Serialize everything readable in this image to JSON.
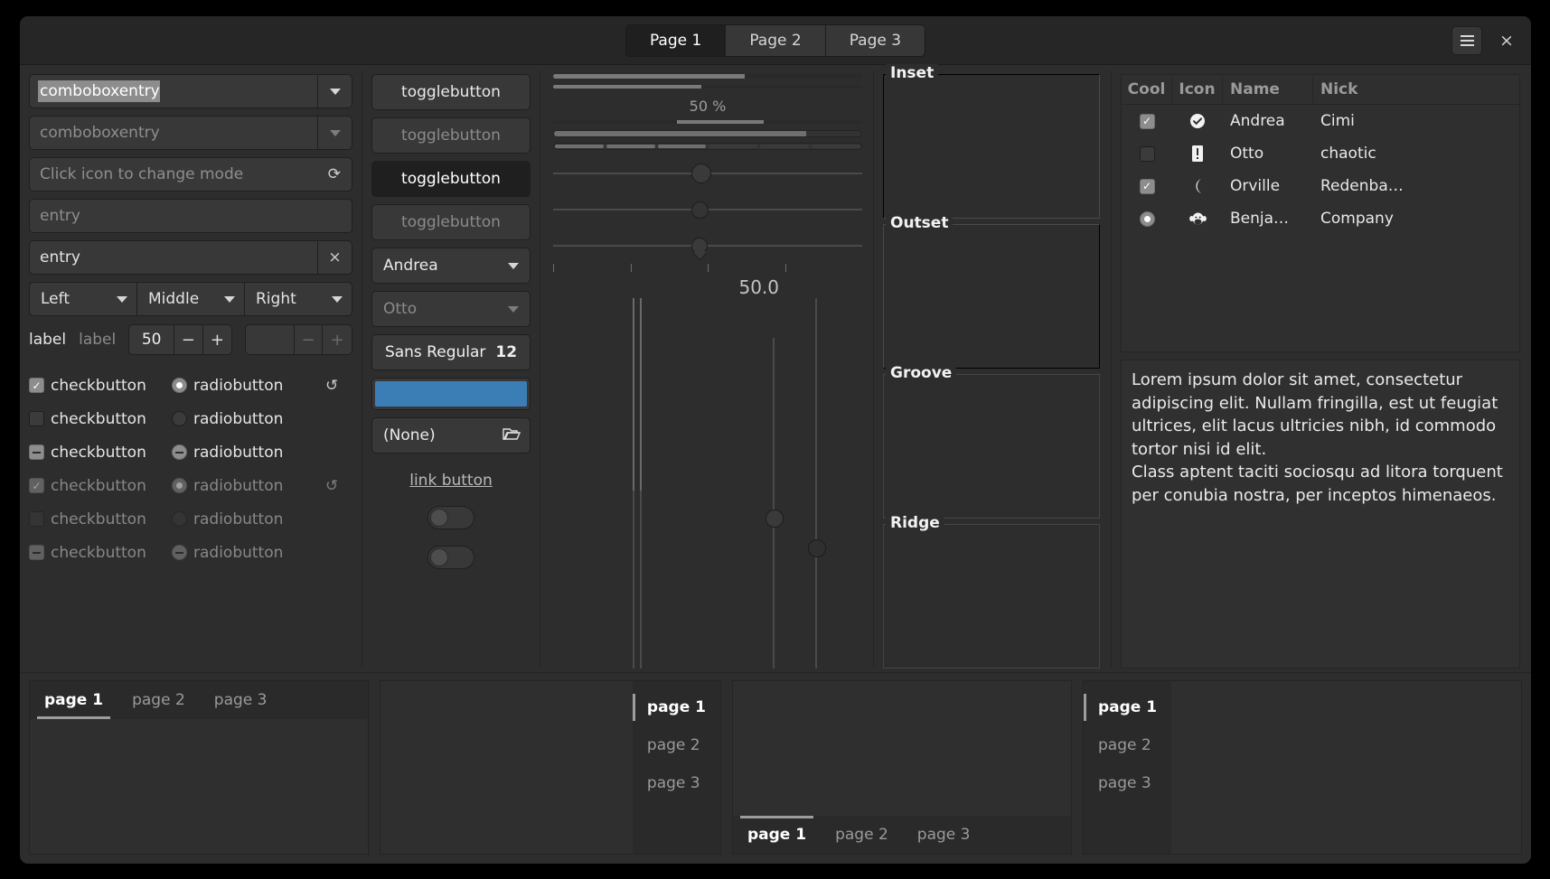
{
  "header": {
    "stack_tabs": [
      {
        "label": "Page 1",
        "active": true
      },
      {
        "label": "Page 2",
        "active": false
      },
      {
        "label": "Page 3",
        "active": false
      }
    ],
    "menu_icon": "hamburger-menu-icon",
    "close_label": "×"
  },
  "column1": {
    "combo_entry_1": {
      "value": "comboboxentry",
      "selected": true
    },
    "combo_entry_2": {
      "value": "comboboxentry",
      "disabled": true
    },
    "mode_entry": {
      "placeholder": "Click icon to change mode",
      "icon": "refresh-icon"
    },
    "entry_placeholder": {
      "placeholder": "entry"
    },
    "entry_filled": {
      "value": "entry",
      "clear_icon": "×"
    },
    "segmented": [
      {
        "label": "Left"
      },
      {
        "label": "Middle"
      },
      {
        "label": "Right"
      }
    ],
    "labels": {
      "label_a": "label",
      "label_b": "label"
    },
    "spin": {
      "value": "50",
      "minus": "−",
      "plus": "+"
    },
    "spin_disabled": {
      "value": "",
      "minus": "−",
      "plus": "+"
    },
    "check_rows": [
      {
        "check_state": "on",
        "check_label": "checkbutton",
        "radio_state": "on",
        "radio_label": "radiobutton",
        "spinner": true,
        "disabled": false
      },
      {
        "check_state": "off",
        "check_label": "checkbutton",
        "radio_state": "off",
        "radio_label": "radiobutton",
        "spinner": false,
        "disabled": false
      },
      {
        "check_state": "mixed",
        "check_label": "checkbutton",
        "radio_state": "mixed",
        "radio_label": "radiobutton",
        "spinner": false,
        "disabled": false
      },
      {
        "check_state": "on",
        "check_label": "checkbutton",
        "radio_state": "on",
        "radio_label": "radiobutton",
        "spinner": true,
        "disabled": true
      },
      {
        "check_state": "off",
        "check_label": "checkbutton",
        "radio_state": "off",
        "radio_label": "radiobutton",
        "spinner": false,
        "disabled": true
      },
      {
        "check_state": "mixed",
        "check_label": "checkbutton",
        "radio_state": "mixed",
        "radio_label": "radiobutton",
        "spinner": false,
        "disabled": true
      }
    ],
    "spinner_glyph": "↺"
  },
  "column2": {
    "toggles": [
      {
        "label": "togglebutton",
        "state": "normal"
      },
      {
        "label": "togglebutton",
        "state": "disabled"
      },
      {
        "label": "togglebutton",
        "state": "pressed"
      },
      {
        "label": "togglebutton",
        "state": "disabled"
      }
    ],
    "combo_normal": "Andrea",
    "combo_disabled": "Otto",
    "font_button": {
      "family": "Sans Regular",
      "size": "12"
    },
    "color_button": {
      "color": "#3a7eb5"
    },
    "file_button": {
      "label": "(None)",
      "icon": "folder-open-icon"
    },
    "link_button": "link button",
    "switches": [
      {
        "state": "off"
      },
      {
        "state": "off"
      }
    ]
  },
  "column3": {
    "progress_1": 62,
    "progress_2": 48,
    "percent_label": "50 %",
    "progress_3_start": 40,
    "progress_3_end": 68,
    "level_bar_value": 82,
    "level_bar_discrete": [
      1,
      1,
      1,
      0,
      0,
      0
    ],
    "scale_1": 48,
    "scale_2": 48,
    "scale_3": 48,
    "ticks": [
      0,
      25,
      50,
      75
    ],
    "big_value": "50.0",
    "vscrollbar_left_value": 28,
    "vscrollbar_mid_value": 65,
    "vscale_value": 57
  },
  "frames": [
    {
      "label": "Inset",
      "style": "inset"
    },
    {
      "label": "Outset",
      "style": "outset"
    },
    {
      "label": "Groove",
      "style": "groove"
    },
    {
      "label": "Ridge",
      "style": "ridge"
    }
  ],
  "treeview": {
    "columns": [
      "Cool",
      "Icon",
      "Name",
      "Nick"
    ],
    "rows": [
      {
        "cool": "check-on",
        "icon": "check-circle-icon",
        "icon_glyph": "✔",
        "name": "Andrea",
        "nick": "Cimi"
      },
      {
        "cool": "check-off",
        "icon": "warning-icon",
        "icon_glyph": "❗",
        "name": "Otto",
        "nick": "chaotic"
      },
      {
        "cool": "check-on",
        "icon": "moon-icon",
        "icon_glyph": "☾",
        "name": "Orville",
        "nick": "Redenba…"
      },
      {
        "cool": "radio-on",
        "icon": "monkey-face-icon",
        "icon_glyph": "ὃ5",
        "name": "Benja…",
        "nick": "Company"
      }
    ]
  },
  "textview": {
    "paragraph_1": "Lorem ipsum dolor sit amet, consectetur adipiscing elit. Nullam fringilla, est ut feugiat ultrices, elit lacus ultricies nibh, id commodo tortor nisi id elit.",
    "paragraph_2": "Class aptent taciti sociosqu ad litora torquent per conubia nostra, per inceptos himenaeos."
  },
  "notebooks": [
    {
      "position": "top",
      "tabs": [
        {
          "label": "page 1",
          "active": true
        },
        {
          "label": "page 2",
          "active": false
        },
        {
          "label": "page 3",
          "active": false
        }
      ]
    },
    {
      "position": "right",
      "tabs": [
        {
          "label": "page 1",
          "active": true
        },
        {
          "label": "page 2",
          "active": false
        },
        {
          "label": "page 3",
          "active": false
        }
      ]
    },
    {
      "position": "bottom",
      "tabs": [
        {
          "label": "page 1",
          "active": true
        },
        {
          "label": "page 2",
          "active": false
        },
        {
          "label": "page 3",
          "active": false
        }
      ]
    },
    {
      "position": "left",
      "tabs": [
        {
          "label": "page 1",
          "active": true
        },
        {
          "label": "page 2",
          "active": false
        },
        {
          "label": "page 3",
          "active": false
        }
      ]
    }
  ]
}
